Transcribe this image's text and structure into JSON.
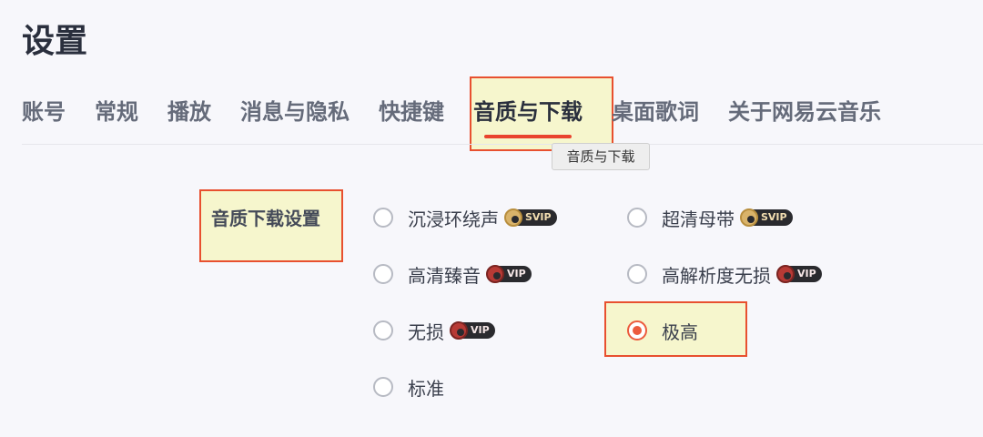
{
  "page": {
    "title": "设置"
  },
  "tabs": [
    {
      "label": "账号"
    },
    {
      "label": "常规"
    },
    {
      "label": "播放"
    },
    {
      "label": "消息与隐私"
    },
    {
      "label": "快捷键"
    },
    {
      "label": "音质与下载",
      "active": true
    },
    {
      "label": "桌面歌词"
    },
    {
      "label": "关于网易云音乐"
    }
  ],
  "tooltip": {
    "text": "音质与下载"
  },
  "section": {
    "label": "音质下载设置"
  },
  "options": [
    {
      "label": "沉浸环绕声",
      "badge": "SVIP",
      "checked": false
    },
    {
      "label": "超清母带",
      "badge": "SVIP",
      "checked": false
    },
    {
      "label": "高清臻音",
      "badge": "VIP",
      "checked": false
    },
    {
      "label": "高解析度无损",
      "badge": "VIP",
      "checked": false
    },
    {
      "label": "无损",
      "badge": "VIP",
      "checked": false
    },
    {
      "label": "极高",
      "badge": "",
      "checked": true
    },
    {
      "label": "标准",
      "badge": "",
      "checked": false
    }
  ],
  "colors": {
    "accent": "#ec5b3d",
    "highlight_border": "#e8502f",
    "highlight_fill": "#f5f5c8"
  }
}
